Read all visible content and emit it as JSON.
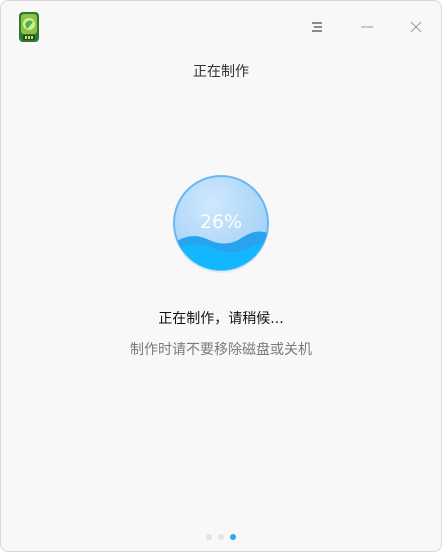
{
  "header": {
    "menu_icon": "hamburger-menu-icon",
    "minimize_icon": "minimize-icon",
    "close_icon": "close-icon"
  },
  "page": {
    "title": "正在制作"
  },
  "progress": {
    "percent": 26,
    "label": "26%",
    "colors": {
      "ring": "#7cc3f6",
      "fill_light": "#b6dcfb",
      "wave_back": "#2aa3ee",
      "wave_front": "#13b7ff"
    }
  },
  "status": {
    "main": "正在制作，请稍候...",
    "sub": "制作时请不要移除磁盘或关机"
  },
  "pager": {
    "count": 3,
    "active_index": 2,
    "active_color": "#2ca7f8"
  }
}
